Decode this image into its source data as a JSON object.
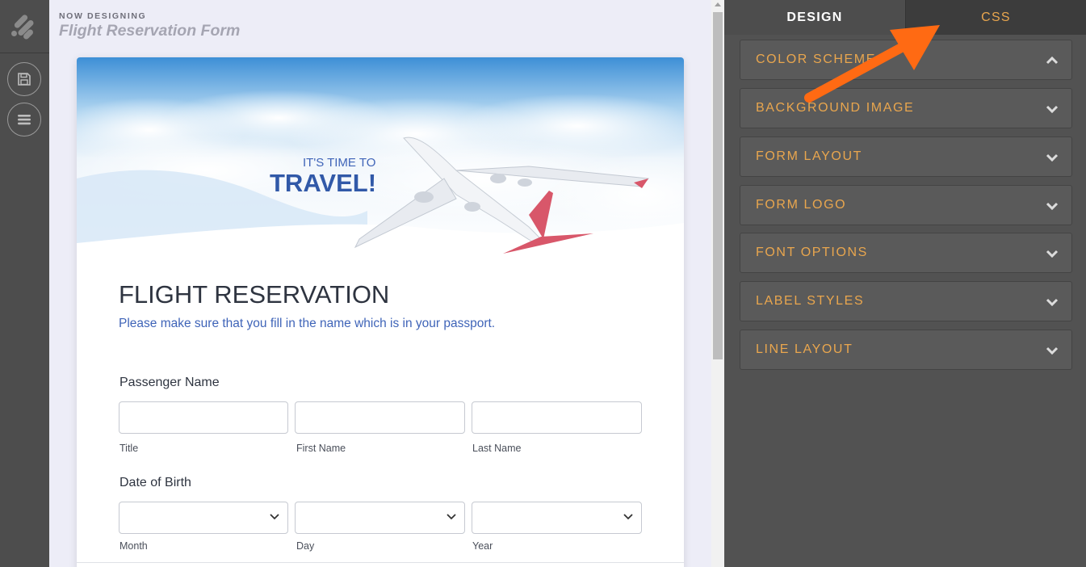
{
  "header": {
    "now_designing": "NOW DESIGNING",
    "form_name": "Flight Reservation Form"
  },
  "rail": {
    "icons": [
      "logo-icon",
      "save-icon",
      "menu-icon"
    ]
  },
  "form": {
    "hero": {
      "tagline_small": "IT'S TIME TO",
      "tagline_big": "TRAVEL!"
    },
    "title": "FLIGHT RESERVATION",
    "subtitle": "Please make sure that you fill in the name which is in your passport.",
    "passenger": {
      "label": "Passenger Name",
      "fields": [
        {
          "sublabel": "Title",
          "value": ""
        },
        {
          "sublabel": "First Name",
          "value": ""
        },
        {
          "sublabel": "Last Name",
          "value": ""
        }
      ]
    },
    "dob": {
      "label": "Date of Birth",
      "fields": [
        {
          "sublabel": "Month",
          "value": ""
        },
        {
          "sublabel": "Day",
          "value": ""
        },
        {
          "sublabel": "Year",
          "value": ""
        }
      ]
    }
  },
  "panel": {
    "tabs": [
      {
        "label": "DESIGN",
        "active": true
      },
      {
        "label": "CSS",
        "active": false
      }
    ],
    "sections": [
      {
        "label": "COLOR SCHEME",
        "expanded": true
      },
      {
        "label": "BACKGROUND IMAGE",
        "expanded": false
      },
      {
        "label": "FORM LAYOUT",
        "expanded": false
      },
      {
        "label": "FORM LOGO",
        "expanded": false
      },
      {
        "label": "FONT OPTIONS",
        "expanded": false
      },
      {
        "label": "LABEL STYLES",
        "expanded": false
      },
      {
        "label": "LINE LAYOUT",
        "expanded": false
      }
    ]
  },
  "colors": {
    "accent": "#e9a64e",
    "annotation_arrow": "#ff6a13",
    "panel_bg": "#525252",
    "form_blue": "#3f64b8"
  }
}
